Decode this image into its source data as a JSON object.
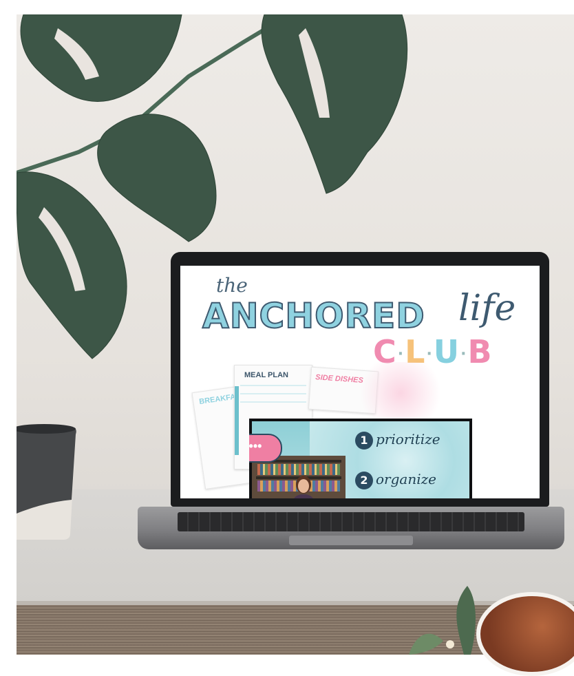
{
  "screen": {
    "brand": {
      "the": "the",
      "main": "ANCHORED",
      "life": "life",
      "club_letters": [
        "C",
        "L",
        "U",
        "B"
      ],
      "club_colors": [
        "#f08bb0",
        "#f6c27a",
        "#86d0df",
        "#f08bb0"
      ]
    },
    "papers": [
      {
        "title": "MEAL PLAN"
      },
      {
        "title": "BREAKFAST"
      },
      {
        "title": "SIDE DISHES"
      }
    ],
    "video": {
      "bubble": "•••",
      "items": [
        {
          "num": "1",
          "label": "prioritize"
        },
        {
          "num": "2",
          "label": "organize"
        }
      ]
    }
  },
  "colors": {
    "wall": "#e9e4df",
    "desk": "#d4d2ce",
    "leaf": "#3f5a4a",
    "brand_teal": "#8fd2e0",
    "brand_navy": "#3e5a70"
  }
}
